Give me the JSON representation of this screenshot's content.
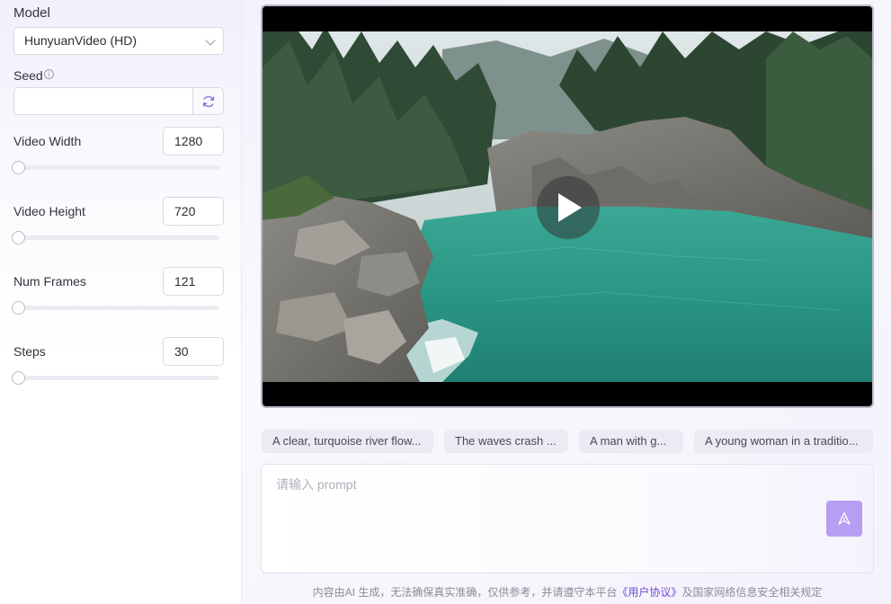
{
  "sidebar": {
    "model_label": "Model",
    "model_value": "HunyuanVideo (HD)",
    "seed_label": "Seed",
    "seed_info_glyph": "i",
    "seed_value": "",
    "width_label": "Video Width",
    "width_value": "1280",
    "height_label": "Video Height",
    "height_value": "720",
    "frames_label": "Num Frames",
    "frames_value": "121",
    "steps_label": "Steps",
    "steps_value": "30"
  },
  "suggestions": [
    "A clear, turquoise river flow...",
    "The waves crash ...",
    "A man with g...",
    "A young woman in a traditio..."
  ],
  "prompt": {
    "placeholder": "请输入 prompt",
    "value": ""
  },
  "footer": {
    "before": "内容由AI 生成，无法确保真实准确，仅供参考，并请遵守本平台",
    "link": "《用户协议》",
    "after": "及国家网络信息安全相关规定"
  },
  "colors": {
    "accent": "#b79ef2",
    "link": "#6f47d9",
    "water": "#2a9d8a"
  },
  "icons": {
    "refresh": "refresh-icon",
    "send": "send-icon",
    "play": "play-icon",
    "chevron": "chevron-down-icon",
    "info": "info-icon"
  }
}
